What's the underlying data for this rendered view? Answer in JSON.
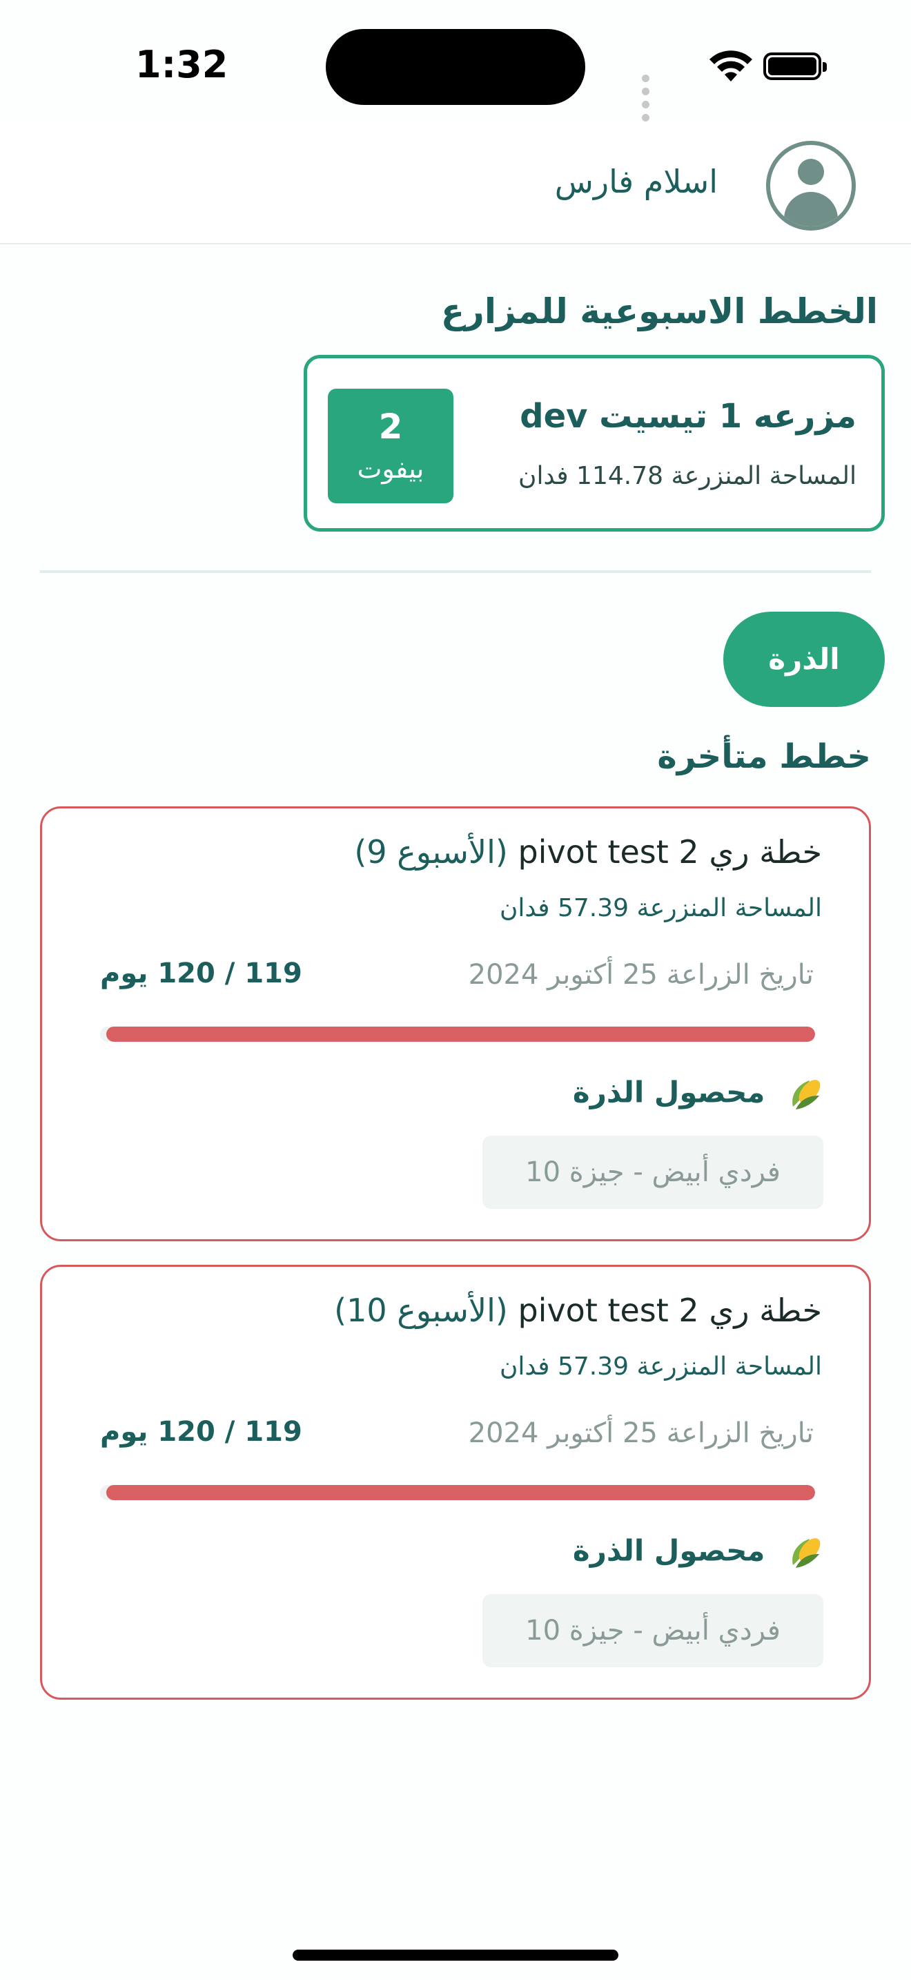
{
  "status_bar": {
    "time": "1:32"
  },
  "header": {
    "user_name": "اسلام فارس",
    "avatar_icon": "user-avatar-icon"
  },
  "section": {
    "title": "الخطط الاسبوعية للمزارع"
  },
  "farm": {
    "name": "مزرعه 1 تيسيت dev",
    "area": "المساحة المنزرعة 114.78 فدان",
    "pivot_count": "2",
    "pivot_label": "بيفوت"
  },
  "crop_filter": {
    "selected": "الذرة"
  },
  "late_plans": {
    "title": "خطط متأخرة"
  },
  "plans": [
    {
      "title_main": "خطة ري pivot test 2",
      "title_week": "(الأسبوع 9)",
      "area": "المساحة المنزرعة 57.39 فدان",
      "planting_date": "تاريخ الزراعة 25 أكتوبر 2024",
      "days": "119 / 120 يوم",
      "progress": 0.9917,
      "crop": "محصول الذرة",
      "crop_icon": "corn-icon",
      "variety": "فردي أبيض - جيزة 10"
    },
    {
      "title_main": "خطة ري pivot test 2",
      "title_week": "(الأسبوع 10)",
      "area": "المساحة المنزرعة 57.39 فدان",
      "planting_date": "تاريخ الزراعة 25 أكتوبر 2024",
      "days": "119 / 120 يوم",
      "progress": 0.9917,
      "crop": "محصول الذرة",
      "crop_icon": "corn-icon",
      "variety": "فردي أبيض - جيزة 10"
    }
  ],
  "colors": {
    "brand": "#2aa67e",
    "text_primary": "#1c5e5b",
    "late_border": "#d9585c",
    "progress_fill": "#d86062"
  }
}
